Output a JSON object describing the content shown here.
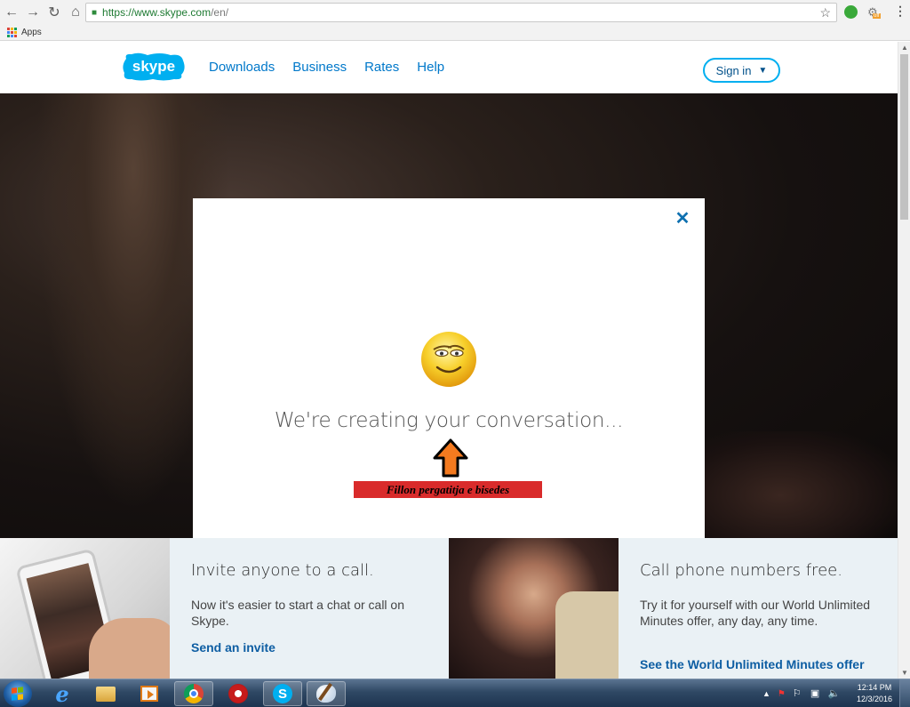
{
  "browser": {
    "url_host": "https://www.skype.com",
    "url_rest": "/en/",
    "bookmarks_apps_label": "Apps"
  },
  "header": {
    "logo_text": "skype",
    "nav": [
      "Downloads",
      "Business",
      "Rates",
      "Help"
    ],
    "signin_label": "Sign in"
  },
  "modal": {
    "message": "We're creating your conversation...",
    "annotation": "Fillon pergatitja e bisedes"
  },
  "cards": [
    {
      "title": "Invite anyone to a call.",
      "body": "Now it's easier to start a chat or call on Skype.",
      "link": "Send an invite"
    },
    {
      "title": "Call phone numbers free.",
      "body": "Try it for yourself with our World Unlimited Minutes offer, any day, any time.",
      "link": "See the World Unlimited Minutes offer"
    }
  ],
  "taskbar": {
    "clock_time": "12:14 PM",
    "clock_date": "12/3/2016"
  },
  "colors": {
    "skype_blue": "#00aff0",
    "nav_link": "#0078ca",
    "card_link": "#0e5ea3",
    "annotation_bg": "#d92b2b",
    "close_icon": "#0e70b0"
  }
}
